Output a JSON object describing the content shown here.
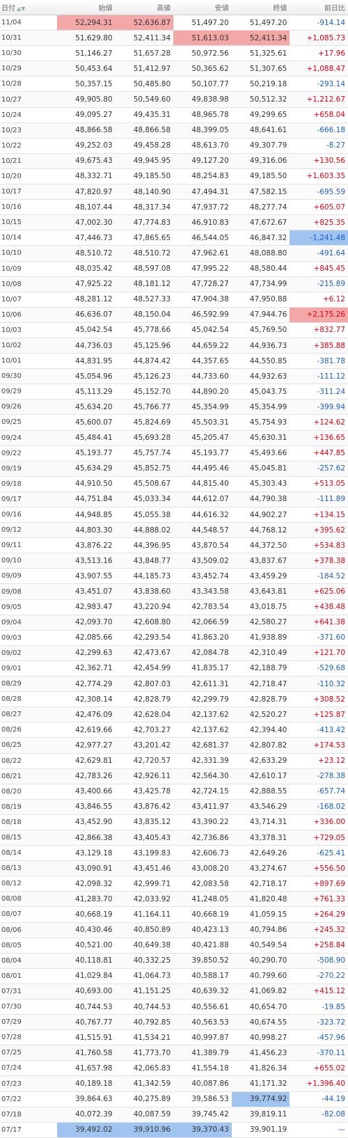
{
  "header": {
    "date": "日付",
    "open": "始値",
    "high": "高値",
    "low": "安値",
    "close": "終値",
    "change": "前日比"
  },
  "colors": {
    "up": "#e60012",
    "down": "#1a5fd0",
    "highlight_red": "#f4a7a7",
    "highlight_blue": "#9fc4ef"
  },
  "rows": [
    {
      "date": "11/04",
      "open": "52,294.31",
      "high": "52,636.87",
      "low": "51,497.20",
      "close": "51,497.20",
      "change": "-914.14",
      "hl": {
        "open": "red",
        "high": "red"
      }
    },
    {
      "date": "10/31",
      "open": "51,629.80",
      "high": "52,411.34",
      "low": "51,613.03",
      "close": "52,411.34",
      "change": "+1,085.73",
      "hl": {
        "low": "red",
        "close": "red"
      }
    },
    {
      "date": "10/30",
      "open": "51,146.27",
      "high": "51,657.28",
      "low": "50,972.56",
      "close": "51,325.61",
      "change": "+17.96"
    },
    {
      "date": "10/29",
      "open": "50,453.64",
      "high": "51,412.97",
      "low": "50,365.62",
      "close": "51,307.65",
      "change": "+1,088.47"
    },
    {
      "date": "10/28",
      "open": "50,357.15",
      "high": "50,485.80",
      "low": "50,107.77",
      "close": "50,219.18",
      "change": "-293.14"
    },
    {
      "date": "10/27",
      "open": "49,905.80",
      "high": "50,549.60",
      "low": "49,838.98",
      "close": "50,512.32",
      "change": "+1,212.67"
    },
    {
      "date": "10/24",
      "open": "49,095.27",
      "high": "49,435.31",
      "low": "48,965.78",
      "close": "49,299.65",
      "change": "+658.04"
    },
    {
      "date": "10/23",
      "open": "48,866.58",
      "high": "48,866.58",
      "low": "48,399.05",
      "close": "48,641.61",
      "change": "-666.18"
    },
    {
      "date": "10/22",
      "open": "49,252.03",
      "high": "49,458.28",
      "low": "48,613.70",
      "close": "49,307.79",
      "change": "-8.27"
    },
    {
      "date": "10/21",
      "open": "49,675.43",
      "high": "49,945.95",
      "low": "49,127.20",
      "close": "49,316.06",
      "change": "+130.56"
    },
    {
      "date": "10/20",
      "open": "48,332.71",
      "high": "49,185.50",
      "low": "48,254.83",
      "close": "49,185.50",
      "change": "+1,603.35"
    },
    {
      "date": "10/17",
      "open": "47,820.97",
      "high": "48,140.90",
      "low": "47,494.31",
      "close": "47,582.15",
      "change": "-695.59"
    },
    {
      "date": "10/16",
      "open": "48,107.44",
      "high": "48,317.34",
      "low": "47,937.72",
      "close": "48,277.74",
      "change": "+605.07"
    },
    {
      "date": "10/15",
      "open": "47,002.30",
      "high": "47,774.83",
      "low": "46,910.83",
      "close": "47,672.67",
      "change": "+825.35"
    },
    {
      "date": "10/14",
      "open": "47,446.73",
      "high": "47,865.65",
      "low": "46,544.05",
      "close": "46,847.32",
      "change": "-1,241.48",
      "hl": {
        "change": "blue"
      }
    },
    {
      "date": "10/10",
      "open": "48,510.72",
      "high": "48,510.72",
      "low": "47,962.61",
      "close": "48,088.80",
      "change": "-491.64"
    },
    {
      "date": "10/09",
      "open": "48,035.42",
      "high": "48,597.08",
      "low": "47,995.22",
      "close": "48,580.44",
      "change": "+845.45"
    },
    {
      "date": "10/08",
      "open": "47,925.22",
      "high": "48,181.12",
      "low": "47,728.27",
      "close": "47,734.99",
      "change": "-215.89"
    },
    {
      "date": "10/07",
      "open": "48,281.12",
      "high": "48,527.33",
      "low": "47,904.38",
      "close": "47,950.88",
      "change": "+6.12"
    },
    {
      "date": "10/06",
      "open": "46,636.07",
      "high": "48,150.04",
      "low": "46,592.99",
      "close": "47,944.76",
      "change": "+2,175.26",
      "hl": {
        "change": "red"
      }
    },
    {
      "date": "10/03",
      "open": "45,042.54",
      "high": "45,778.66",
      "low": "45,042.54",
      "close": "45,769.50",
      "change": "+832.77"
    },
    {
      "date": "10/02",
      "open": "44,736.03",
      "high": "45,125.96",
      "low": "44,659.22",
      "close": "44,936.73",
      "change": "+385.88"
    },
    {
      "date": "10/01",
      "open": "44,831.95",
      "high": "44,874.42",
      "low": "44,357.65",
      "close": "44,550.85",
      "change": "-381.78"
    },
    {
      "date": "09/30",
      "open": "45,054.96",
      "high": "45,126.23",
      "low": "44,733.60",
      "close": "44,932.63",
      "change": "-111.12"
    },
    {
      "date": "09/29",
      "open": "45,113.29",
      "high": "45,152.70",
      "low": "44,890.20",
      "close": "45,043.75",
      "change": "-311.24"
    },
    {
      "date": "09/26",
      "open": "45,634.20",
      "high": "45,766.77",
      "low": "45,354.99",
      "close": "45,354.99",
      "change": "-399.94"
    },
    {
      "date": "09/25",
      "open": "45,600.07",
      "high": "45,824.69",
      "low": "45,503.31",
      "close": "45,754.93",
      "change": "+124.62"
    },
    {
      "date": "09/24",
      "open": "45,484.41",
      "high": "45,693.28",
      "low": "45,205.47",
      "close": "45,630.31",
      "change": "+136.65"
    },
    {
      "date": "09/22",
      "open": "45,193.77",
      "high": "45,757.74",
      "low": "45,193.77",
      "close": "45,493.66",
      "change": "+447.85"
    },
    {
      "date": "09/19",
      "open": "45,634.29",
      "high": "45,852.75",
      "low": "44,495.46",
      "close": "45,045.81",
      "change": "-257.62"
    },
    {
      "date": "09/18",
      "open": "44,910.50",
      "high": "45,508.67",
      "low": "44,815.40",
      "close": "45,303.43",
      "change": "+513.05"
    },
    {
      "date": "09/17",
      "open": "44,751.84",
      "high": "45,033.34",
      "low": "44,612.07",
      "close": "44,790.38",
      "change": "-111.89"
    },
    {
      "date": "09/16",
      "open": "44,948.85",
      "high": "45,055.38",
      "low": "44,616.32",
      "close": "44,902.27",
      "change": "+134.15"
    },
    {
      "date": "09/12",
      "open": "44,803.30",
      "high": "44,888.02",
      "low": "44,548.57",
      "close": "44,768.12",
      "change": "+395.62"
    },
    {
      "date": "09/11",
      "open": "43,876.22",
      "high": "44,396.95",
      "low": "43,870.54",
      "close": "44,372.50",
      "change": "+534.83"
    },
    {
      "date": "09/10",
      "open": "43,513.16",
      "high": "43,848.77",
      "low": "43,509.02",
      "close": "43,837.67",
      "change": "+378.38"
    },
    {
      "date": "09/09",
      "open": "43,907.55",
      "high": "44,185.73",
      "low": "43,452.74",
      "close": "43,459.29",
      "change": "-184.52"
    },
    {
      "date": "09/08",
      "open": "43,451.07",
      "high": "43,838.60",
      "low": "43,343.58",
      "close": "43,643.81",
      "change": "+625.06"
    },
    {
      "date": "09/05",
      "open": "42,983.47",
      "high": "43,220.94",
      "low": "42,783.54",
      "close": "43,018.75",
      "change": "+438.48"
    },
    {
      "date": "09/04",
      "open": "42,093.70",
      "high": "42,608.80",
      "low": "42,066.59",
      "close": "42,580.27",
      "change": "+641.38"
    },
    {
      "date": "09/03",
      "open": "42,085.66",
      "high": "42,293.54",
      "low": "41,863.20",
      "close": "41,938.89",
      "change": "-371.60"
    },
    {
      "date": "09/02",
      "open": "42,299.63",
      "high": "42,473.67",
      "low": "42,084.78",
      "close": "42,310.49",
      "change": "+121.70"
    },
    {
      "date": "09/01",
      "open": "42,362.71",
      "high": "42,454.99",
      "low": "41,835.17",
      "close": "42,188.79",
      "change": "-529.68"
    },
    {
      "date": "08/29",
      "open": "42,774.29",
      "high": "42,807.03",
      "low": "42,611.31",
      "close": "42,718.47",
      "change": "-110.32"
    },
    {
      "date": "08/28",
      "open": "42,308.14",
      "high": "42,828.79",
      "low": "42,299.79",
      "close": "42,828.79",
      "change": "+308.52"
    },
    {
      "date": "08/27",
      "open": "42,476.09",
      "high": "42,628.04",
      "low": "42,137.62",
      "close": "42,520.27",
      "change": "+125.87"
    },
    {
      "date": "08/26",
      "open": "42,619.66",
      "high": "42,703.27",
      "low": "42,137.62",
      "close": "42,394.40",
      "change": "-413.42"
    },
    {
      "date": "08/25",
      "open": "42,977.27",
      "high": "43,201.42",
      "low": "42,681.37",
      "close": "42,807.82",
      "change": "+174.53"
    },
    {
      "date": "08/22",
      "open": "42,629.81",
      "high": "42,720.57",
      "low": "42,331.39",
      "close": "42,633.29",
      "change": "+23.12"
    },
    {
      "date": "08/21",
      "open": "42,783.26",
      "high": "42,926.11",
      "low": "42,564.30",
      "close": "42,610.17",
      "change": "-278.38"
    },
    {
      "date": "08/20",
      "open": "43,400.66",
      "high": "43,425.78",
      "low": "42,724.15",
      "close": "42,888.55",
      "change": "-657.74"
    },
    {
      "date": "08/19",
      "open": "43,846.55",
      "high": "43,876.42",
      "low": "43,411.97",
      "close": "43,546.29",
      "change": "-168.02"
    },
    {
      "date": "08/18",
      "open": "43,452.90",
      "high": "43,835.12",
      "low": "43,390.22",
      "close": "43,714.31",
      "change": "+336.00"
    },
    {
      "date": "08/15",
      "open": "42,866.38",
      "high": "43,405.43",
      "low": "42,736.86",
      "close": "43,378.31",
      "change": "+729.05"
    },
    {
      "date": "08/14",
      "open": "43,129.18",
      "high": "43,199.83",
      "low": "42,606.73",
      "close": "42,649.26",
      "change": "-625.41"
    },
    {
      "date": "08/13",
      "open": "43,090.91",
      "high": "43,451.46",
      "low": "43,008.20",
      "close": "43,274.67",
      "change": "+556.50"
    },
    {
      "date": "08/12",
      "open": "42,098.32",
      "high": "42,999.71",
      "low": "42,083.58",
      "close": "42,718.17",
      "change": "+897.69"
    },
    {
      "date": "08/08",
      "open": "41,283.70",
      "high": "42,033.92",
      "low": "41,248.05",
      "close": "41,820.48",
      "change": "+761.33"
    },
    {
      "date": "08/07",
      "open": "40,668.19",
      "high": "41,164.11",
      "low": "40,668.19",
      "close": "41,059.15",
      "change": "+264.29"
    },
    {
      "date": "08/06",
      "open": "40,430.46",
      "high": "40,850.89",
      "low": "40,423.13",
      "close": "40,794.86",
      "change": "+245.32"
    },
    {
      "date": "08/05",
      "open": "40,521.00",
      "high": "40,649.38",
      "low": "40,421.88",
      "close": "40,549.54",
      "change": "+258.84"
    },
    {
      "date": "08/04",
      "open": "40,118.81",
      "high": "40,332.25",
      "low": "39,850.52",
      "close": "40,290.70",
      "change": "-508.90"
    },
    {
      "date": "08/01",
      "open": "41,029.84",
      "high": "41,064.73",
      "low": "40,588.17",
      "close": "40,799.60",
      "change": "-270.22"
    },
    {
      "date": "07/31",
      "open": "40,693.00",
      "high": "41,151.25",
      "low": "40,639.32",
      "close": "41,069.82",
      "change": "+415.12"
    },
    {
      "date": "07/30",
      "open": "40,744.53",
      "high": "40,744.53",
      "low": "40,556.61",
      "close": "40,654.70",
      "change": "-19.85"
    },
    {
      "date": "07/29",
      "open": "40,767.77",
      "high": "40,792.85",
      "low": "40,563.53",
      "close": "40,674.55",
      "change": "-323.72"
    },
    {
      "date": "07/28",
      "open": "41,515.91",
      "high": "41,534.21",
      "low": "40,997.87",
      "close": "40,998.27",
      "change": "-457.96"
    },
    {
      "date": "07/25",
      "open": "41,760.58",
      "high": "41,773.70",
      "low": "41,389.79",
      "close": "41,456.23",
      "change": "-370.11"
    },
    {
      "date": "07/24",
      "open": "41,657.98",
      "high": "42,065.83",
      "low": "41,554.18",
      "close": "41,826.34",
      "change": "+655.02"
    },
    {
      "date": "07/23",
      "open": "40,189.18",
      "high": "41,342.59",
      "low": "40,087.86",
      "close": "41,171.32",
      "change": "+1,396.40"
    },
    {
      "date": "07/22",
      "open": "39,864.63",
      "high": "40,275.89",
      "low": "39,586.53",
      "close": "39,774.92",
      "change": "-44.19",
      "hl": {
        "close": "blue"
      }
    },
    {
      "date": "07/18",
      "open": "40,072.39",
      "high": "40,087.59",
      "low": "39,745.42",
      "close": "39,819.11",
      "change": "-82.08"
    },
    {
      "date": "07/17",
      "open": "39,492.02",
      "high": "39,910.96",
      "low": "39,370.43",
      "close": "39,901.19",
      "change": "—",
      "hl": {
        "open": "blue",
        "high": "blue",
        "low": "blue"
      }
    }
  ]
}
